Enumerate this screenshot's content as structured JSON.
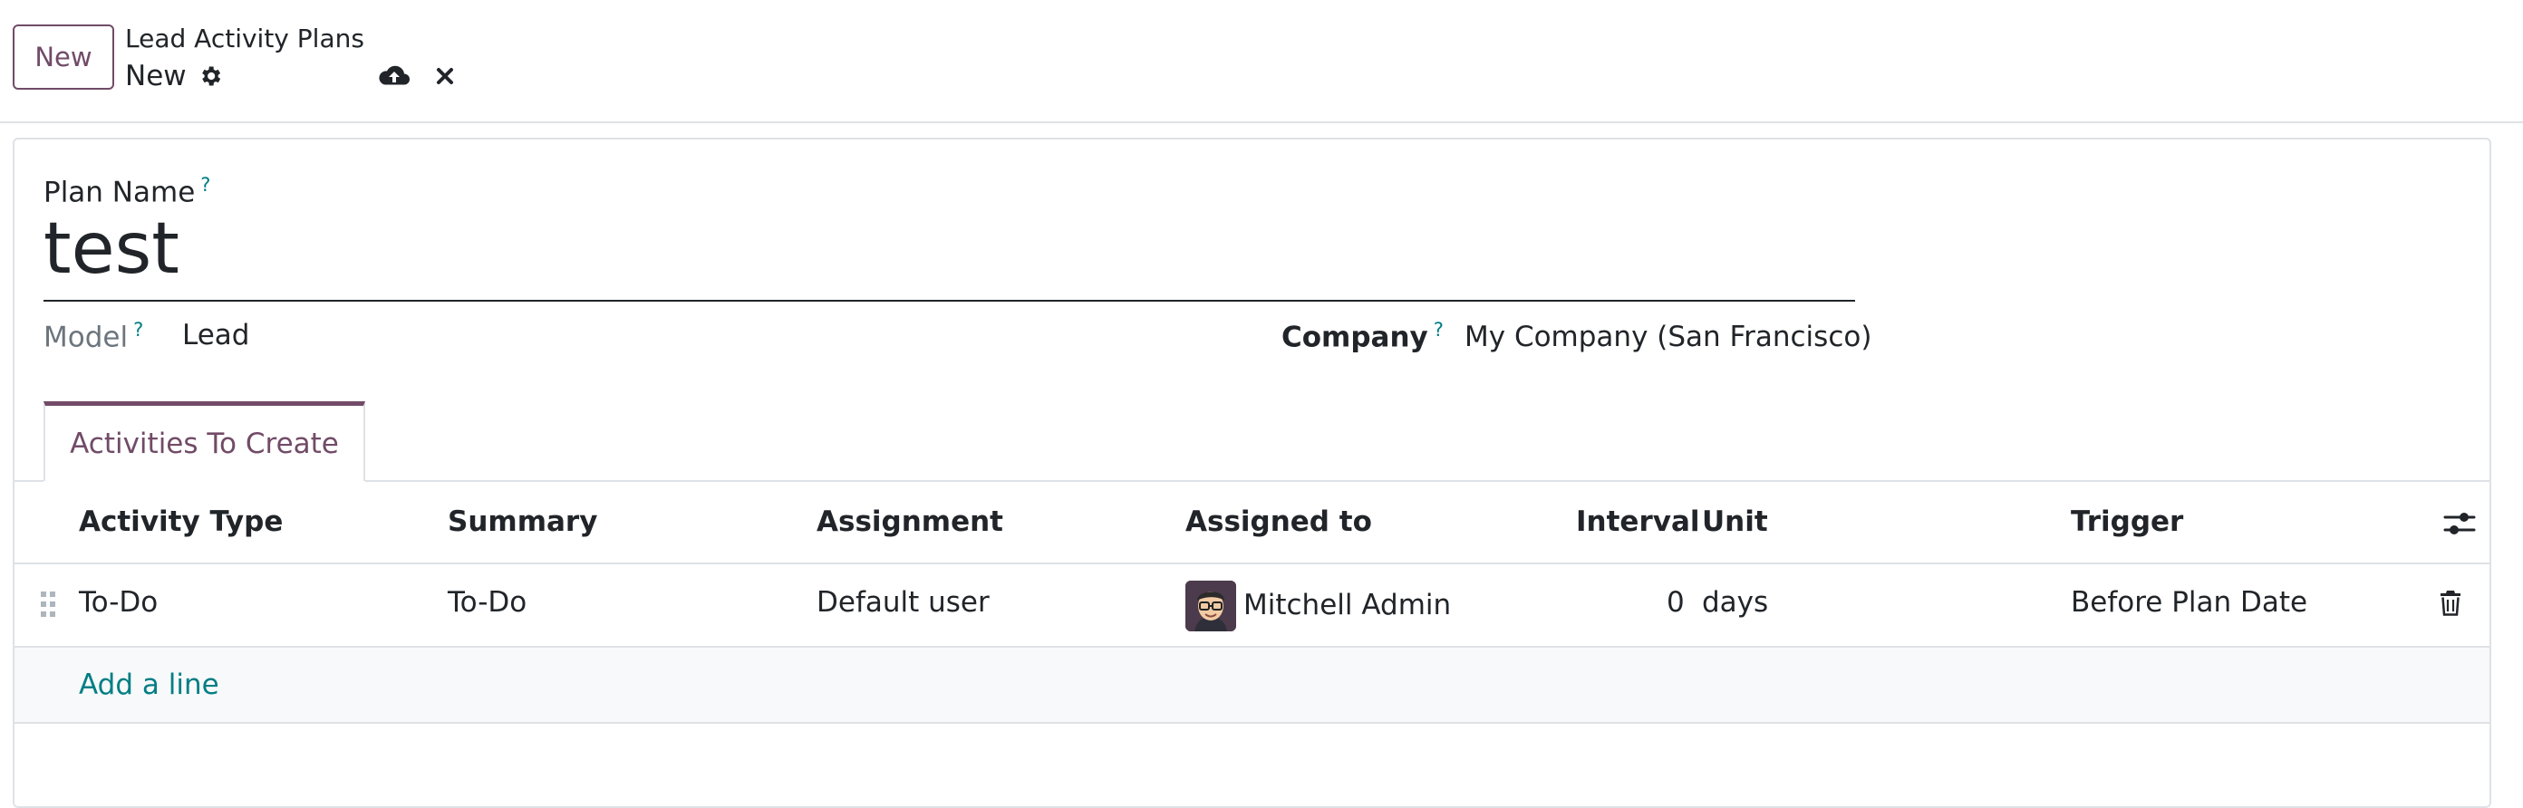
{
  "control_panel": {
    "new_button": "New",
    "breadcrumb": "Lead Activity Plans",
    "record_name": "New",
    "icons": [
      "gear-icon",
      "cloud-upload-icon",
      "close-icon"
    ]
  },
  "form": {
    "plan_name_label": "Plan Name",
    "help_mark": "?",
    "plan_name_value": "test",
    "model_label": "Model",
    "model_value": "Lead",
    "company_label": "Company",
    "company_value": "My Company (San Francisco)"
  },
  "tabs": [
    {
      "label": "Activities To Create",
      "active": true
    }
  ],
  "table": {
    "columns": [
      "Activity Type",
      "Summary",
      "Assignment",
      "Assigned to",
      "Interval",
      "Unit",
      "Trigger"
    ],
    "rows": [
      {
        "activity_type": "To-Do",
        "summary": "To-Do",
        "assignment": "Default user",
        "assigned_to": "Mitchell Admin",
        "interval": "0",
        "unit": "days",
        "trigger": "Before Plan Date"
      }
    ],
    "add_line": "Add a line"
  },
  "colors": {
    "brand": "#714b67",
    "link": "#017e84",
    "border": "#dee2e6"
  }
}
